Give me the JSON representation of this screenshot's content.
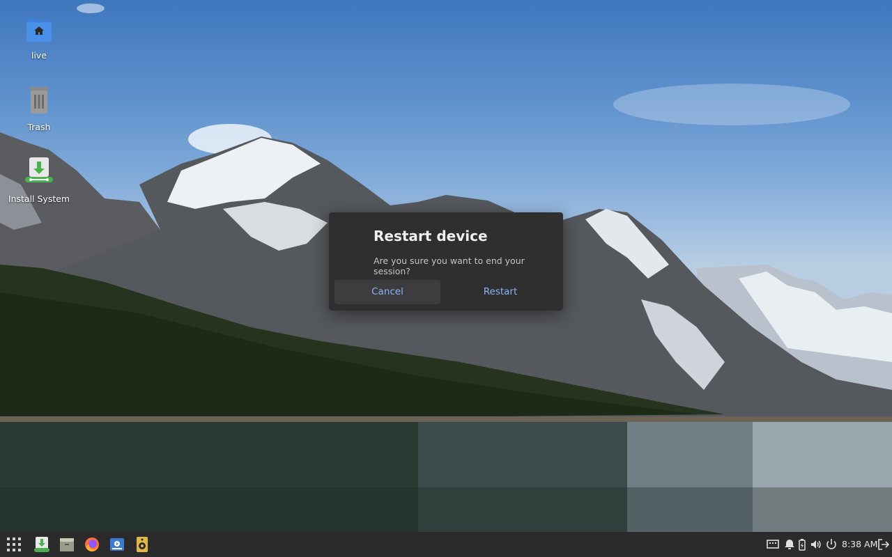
{
  "desktop": {
    "icons": [
      {
        "label": "live"
      },
      {
        "label": "Trash"
      },
      {
        "label": "Install System"
      }
    ]
  },
  "dialog": {
    "title": "Restart device",
    "message": "Are you sure you want to end your session?",
    "cancel_label": "Cancel",
    "confirm_label": "Restart"
  },
  "taskbar": {
    "apps": [
      "app-grid-icon",
      "installer-icon",
      "file-manager-icon",
      "firefox-icon",
      "media-player-icon",
      "speaker-app-icon"
    ],
    "tray": [
      "network-icon",
      "notification-bell-icon",
      "battery-icon",
      "volume-icon",
      "power-icon"
    ],
    "clock": "8:38 AM",
    "logout_icon": "logout-icon"
  },
  "colors": {
    "dialog_bg": "#2f2f2f",
    "accent": "#8ab4f8",
    "taskbar_bg": "#2b2b2b"
  }
}
